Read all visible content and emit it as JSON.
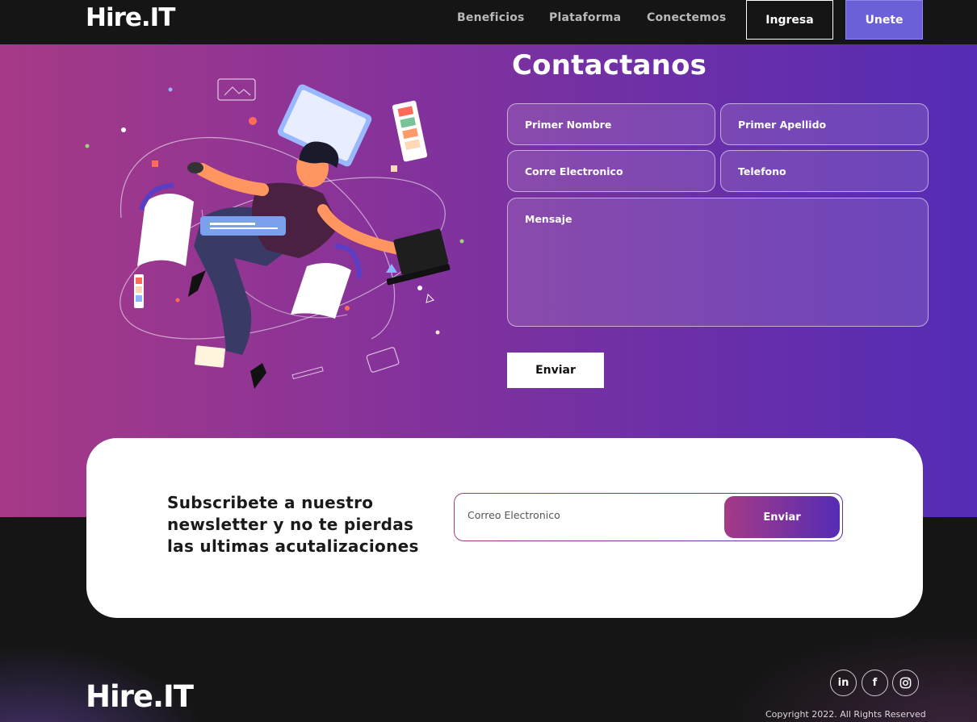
{
  "nav": {
    "logo": "Hire.IT",
    "links": [
      "Beneficios",
      "Plataforma",
      "Conectemos"
    ],
    "login_label": "Ingresa",
    "signup_label": "Unete"
  },
  "contact": {
    "title": "Contactanos",
    "first_name_placeholder": "Primer Nombre",
    "last_name_placeholder": "Primer Apellido",
    "email_placeholder": "Corre Electronico",
    "phone_placeholder": "Telefono",
    "message_placeholder": "Mensaje",
    "submit_label": "Enviar"
  },
  "newsletter": {
    "text": "Subscribete a nuestro newsletter y no te pierdas las ultimas acutalizaciones",
    "email_placeholder": "Correo Electronico",
    "submit_label": "Enviar"
  },
  "footer": {
    "logo": "Hire.IT",
    "social": [
      "linkedin-icon",
      "facebook-icon",
      "instagram-icon"
    ],
    "linkedin_glyph": "in",
    "facebook_glyph": "f",
    "copyright": "Copyright 2022. All Rights Reserved"
  },
  "colors": {
    "gradient_start": "#a63a86",
    "gradient_end": "#552cb5",
    "signup_button": "#6b60d8",
    "background_dark": "#151515"
  }
}
